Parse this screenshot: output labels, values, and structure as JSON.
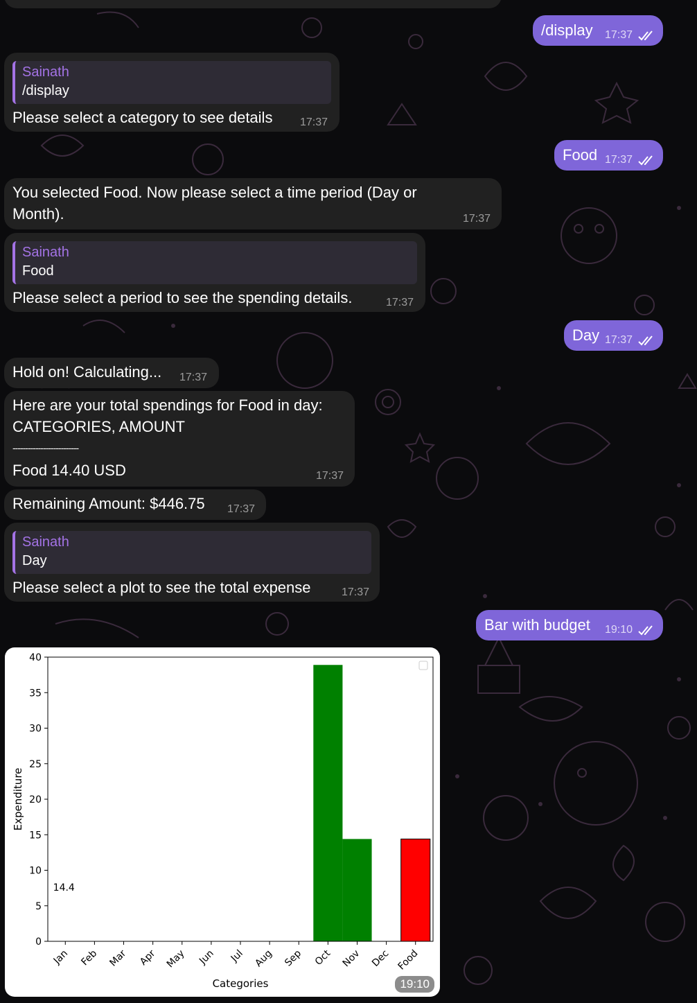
{
  "messages": {
    "out1": {
      "text": "/display",
      "time": "17:37"
    },
    "in1": {
      "quote_name": "Sainath",
      "quote_text": "/display",
      "text": "Please select a category to see details",
      "time": "17:37"
    },
    "out2": {
      "text": "Food",
      "time": "17:37"
    },
    "in2": {
      "line1": "You selected Food. Now please select a time period (Day or",
      "line2": "Month).",
      "time": "17:37"
    },
    "in3": {
      "quote_name": "Sainath",
      "quote_text": "Food",
      "text": "Please select a period to see the spending details.",
      "time": "17:37"
    },
    "out3": {
      "text": "Day",
      "time": "17:37"
    },
    "in4": {
      "text": "Hold on! Calculating...",
      "time": "17:37"
    },
    "in5": {
      "line1": "Here are your total spendings for Food in day:",
      "line2": "CATEGORIES, AMOUNT",
      "line3": "--------------------------",
      "line4": "Food 14.40 USD",
      "time": "17:37"
    },
    "in6": {
      "text": "Remaining Amount: $446.75",
      "time": "17:37"
    },
    "in7": {
      "quote_name": "Sainath",
      "quote_text": "Day",
      "text": "Please select a plot to see the total expense",
      "time": "17:37"
    },
    "out4": {
      "text": "Bar with budget",
      "time": "19:10"
    },
    "photo": {
      "time": "19:10"
    }
  },
  "colors": {
    "outgoing": "#7f66d9",
    "incoming": "#212121",
    "quote_accent": "#a473e6",
    "bar_green": "#008000",
    "bar_red": "#ff0000"
  },
  "chart_data": {
    "type": "bar",
    "title": "",
    "xlabel": "Categories",
    "ylabel": "Expenditure",
    "categories": [
      "Jan",
      "Feb",
      "Mar",
      "Apr",
      "May",
      "Jun",
      "Jul",
      "Aug",
      "Sep",
      "Oct",
      "Nov",
      "Dec",
      "Food"
    ],
    "series": [
      {
        "values": [
          0,
          0,
          0,
          0,
          0,
          0,
          0,
          0,
          0,
          38.9,
          14.4,
          0,
          null
        ],
        "color": "#008000"
      },
      {
        "values": [
          null,
          null,
          null,
          null,
          null,
          null,
          null,
          null,
          null,
          null,
          null,
          null,
          14.4
        ],
        "color": "#ff0000"
      }
    ],
    "annotations": [
      {
        "text": "14.4",
        "x": "Jan",
        "y": 7.6
      }
    ],
    "ylim": [
      0,
      40
    ],
    "yticks": [
      0,
      5,
      10,
      15,
      20,
      25,
      30,
      35,
      40
    ],
    "legend": "top-right, empty",
    "grid": false
  }
}
